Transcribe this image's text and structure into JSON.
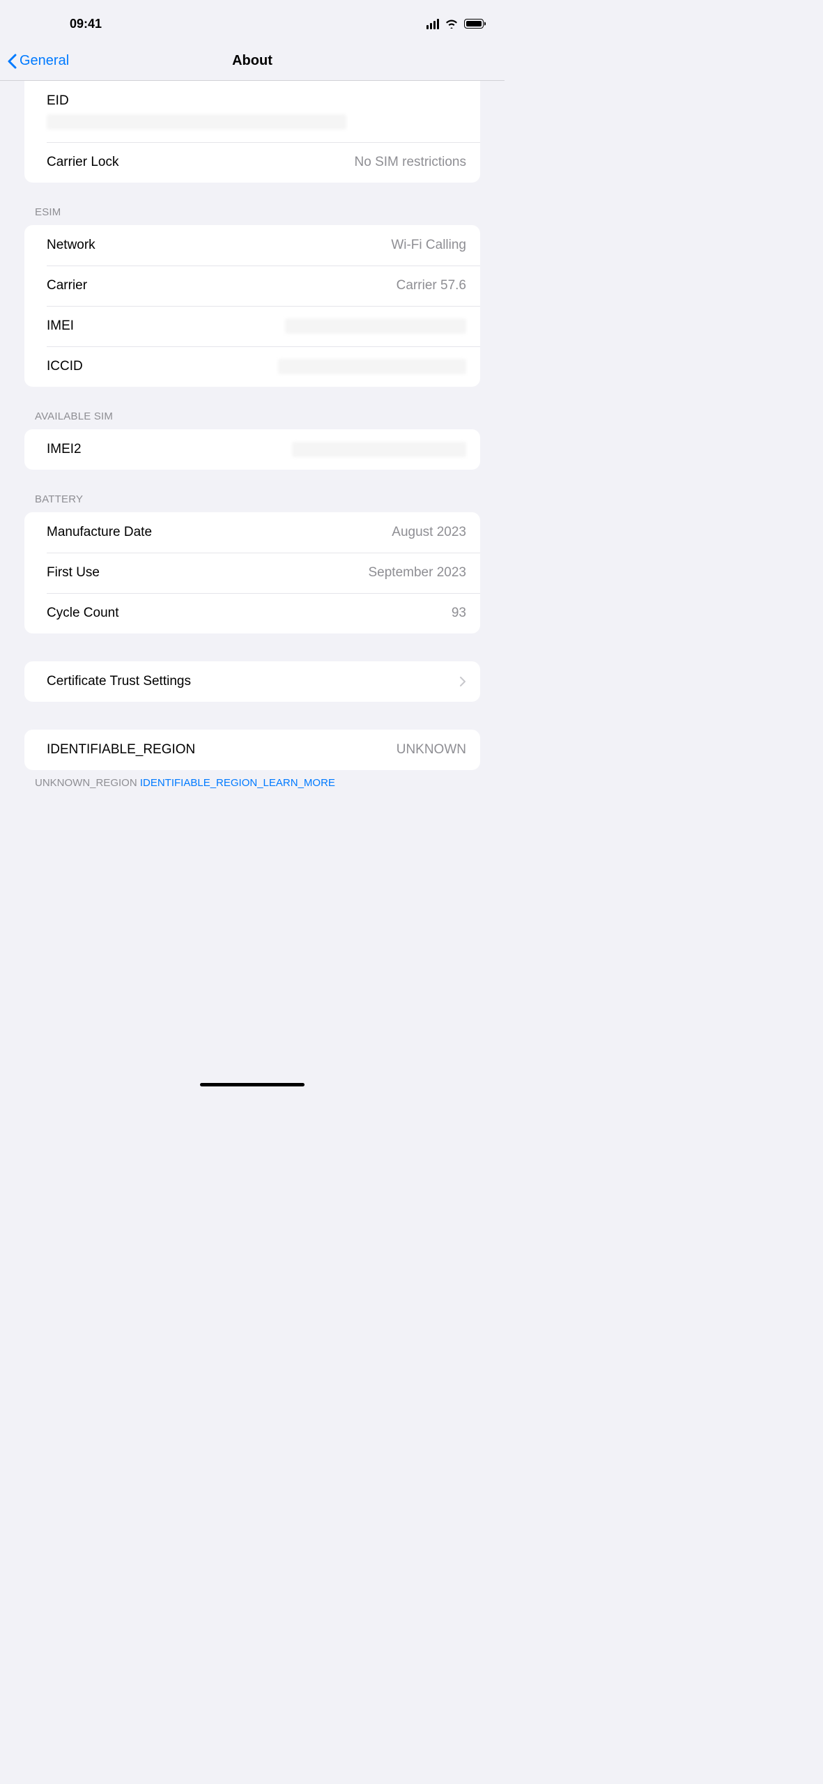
{
  "statusBar": {
    "time": "09:41"
  },
  "nav": {
    "back": "General",
    "title": "About"
  },
  "group1": {
    "eid_label": "EID",
    "carrier_lock_label": "Carrier Lock",
    "carrier_lock_value": "No SIM restrictions"
  },
  "esim": {
    "header": "ESIM",
    "network_label": "Network",
    "network_value": "Wi-Fi Calling",
    "carrier_label": "Carrier",
    "carrier_value": "Carrier 57.6",
    "imei_label": "IMEI",
    "iccid_label": "ICCID"
  },
  "available_sim": {
    "header": "AVAILABLE SIM",
    "imei2_label": "IMEI2"
  },
  "battery": {
    "header": "BATTERY",
    "mfg_label": "Manufacture Date",
    "mfg_value": "August 2023",
    "first_use_label": "First Use",
    "first_use_value": "September 2023",
    "cycle_label": "Cycle Count",
    "cycle_value": "93"
  },
  "cert": {
    "label": "Certificate Trust Settings"
  },
  "region": {
    "label": "IDENTIFIABLE_REGION",
    "value": "UNKNOWN",
    "footer_prefix": "UNKNOWN_REGION ",
    "footer_link": "IDENTIFIABLE_REGION_LEARN_MORE"
  }
}
